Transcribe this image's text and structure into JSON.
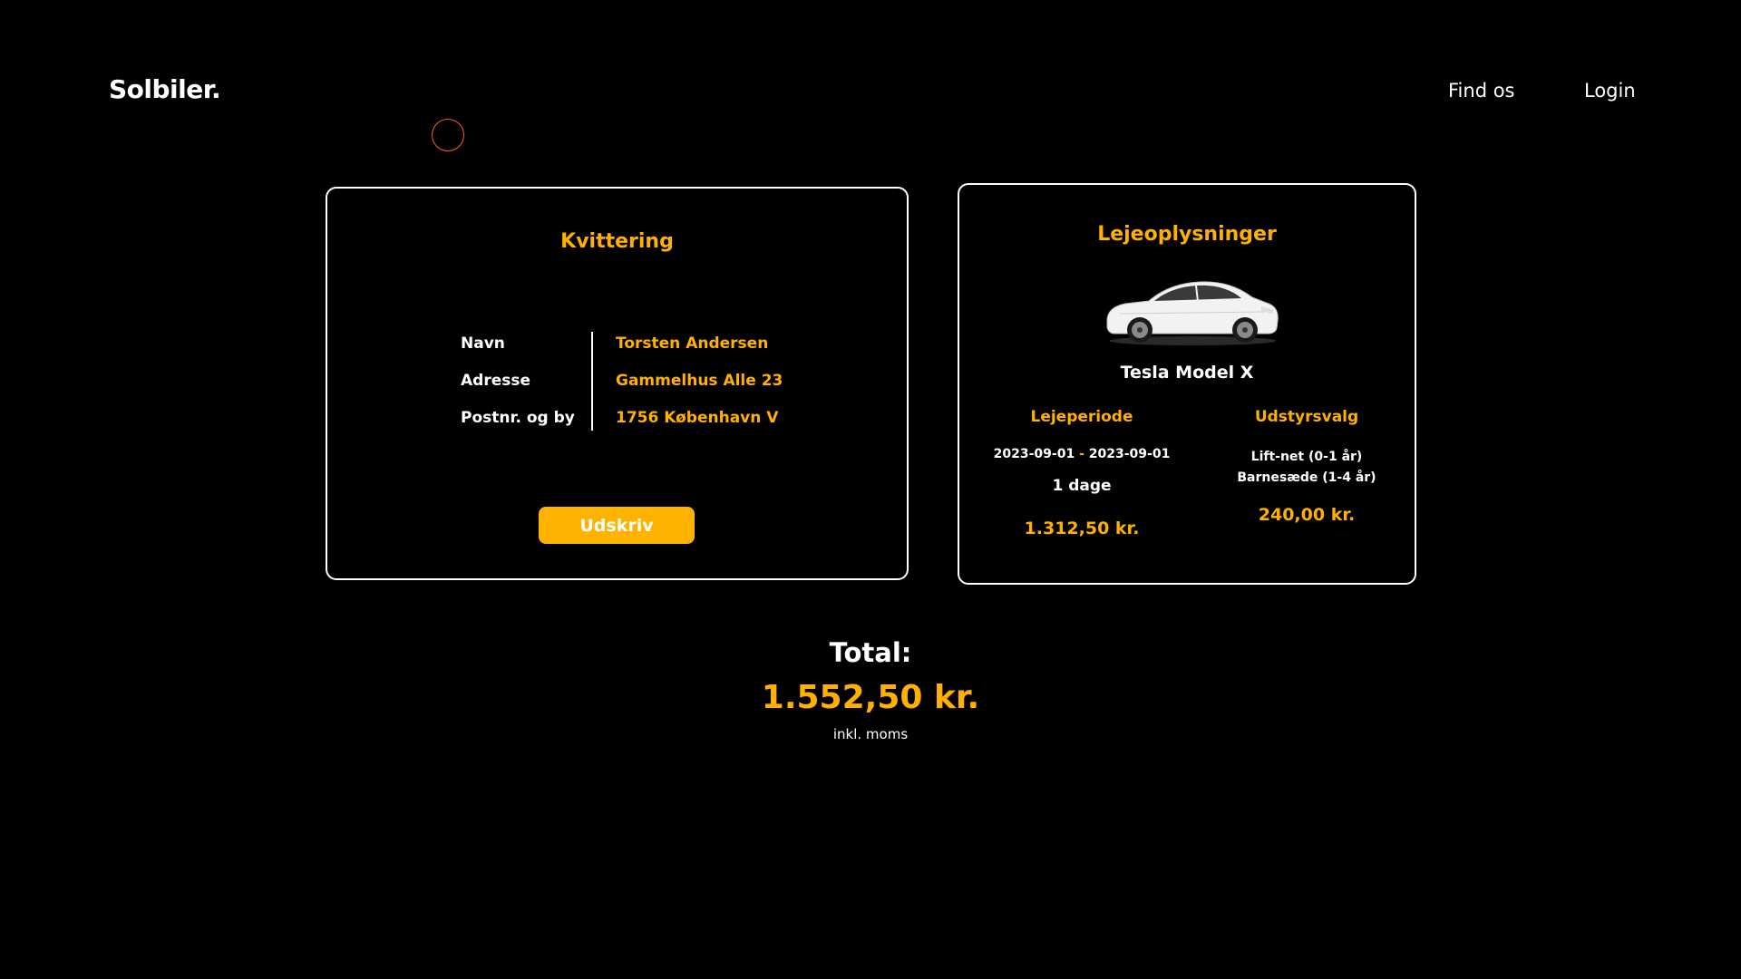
{
  "header": {
    "logo": "Solbiler.",
    "nav": {
      "find_us": "Find os",
      "login": "Login"
    }
  },
  "receipt": {
    "title": "Kvittering",
    "fields": [
      {
        "label": "Navn",
        "value": "Torsten Andersen"
      },
      {
        "label": "Adresse",
        "value": "Gammelhus Alle 23"
      },
      {
        "label": "Postnr. og by",
        "value": "1756 København V"
      }
    ],
    "print_label": "Udskriv"
  },
  "rental": {
    "title": "Lejeoplysninger",
    "car_name": "Tesla Model X",
    "car_icon": "white-suv-car-icon",
    "period": {
      "heading": "Lejeperiode",
      "start": "2023-09-01",
      "separator": "-",
      "end": "2023-09-01",
      "days": "1 dage",
      "price": "1.312,50 kr."
    },
    "equipment": {
      "heading": "Udstyrsvalg",
      "items": [
        "Lift-net (0-1 år)",
        "Barnesæde (1-4 år)"
      ],
      "price": "240,00 kr."
    }
  },
  "total": {
    "label": "Total:",
    "value": "1.552,50 kr.",
    "note": "inkl. moms"
  },
  "colors": {
    "background": "#000000",
    "accent": "#ffb000",
    "text": "#ffffff",
    "cursor_ring": "#ff5a1f"
  }
}
